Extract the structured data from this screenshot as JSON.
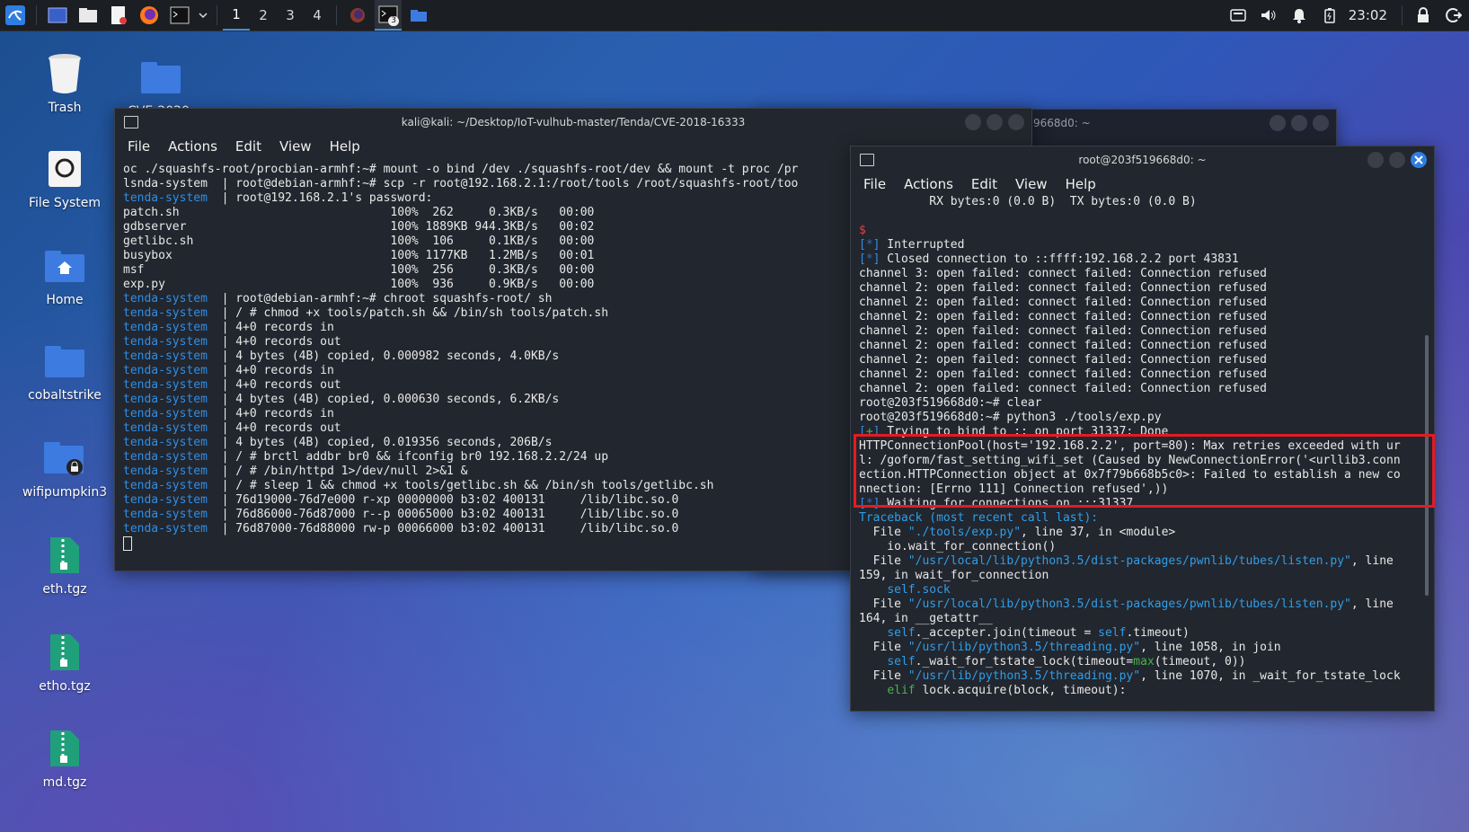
{
  "taskbar": {
    "workspaces": [
      "1",
      "2",
      "3",
      "4"
    ],
    "active_workspace": "1",
    "terminal_badge": "3",
    "clock": "23:02"
  },
  "desktop": {
    "icons": [
      {
        "label": "Trash",
        "icon": "trash-icon"
      },
      {
        "label": "File System",
        "icon": "harddisk-icon"
      },
      {
        "label": "Home",
        "icon": "home-folder-icon"
      },
      {
        "label": "cobaltstrike",
        "icon": "folder-icon"
      },
      {
        "label": "wifipumpkin3",
        "icon": "locked-folder-icon"
      },
      {
        "label": "eth.tgz",
        "icon": "archive-icon"
      },
      {
        "label": "etho.tgz",
        "icon": "archive-icon"
      },
      {
        "label": "md.tgz",
        "icon": "archive-icon"
      }
    ],
    "cve_folder_label": "CVE-2020-"
  },
  "menu": {
    "file": "File",
    "actions": "Actions",
    "edit": "Edit",
    "view": "View",
    "help": "Help"
  },
  "bg_window_title": "9668d0: ~",
  "left_terminal": {
    "title": "kali@kali: ~/Desktop/IoT-vulhub-master/Tenda/CVE-2018-16333",
    "lines": [
      {
        "prefix": "",
        "text": "oc ./squashfs-root/procbian-armhf:~# mount -o bind /dev ./squashfs-root/dev && mount -t proc /pr"
      },
      {
        "prefix": "ls",
        "text": "nda-system  | root@debian-armhf:~# scp -r root@192.168.2.1:/root/tools /root/squashfs-root/too"
      },
      {
        "prefix": "tenda-system",
        "text": "  | root@192.168.2.1's password:"
      },
      {
        "prefix": "",
        "text": "patch.sh                              100%  262     0.3KB/s   00:00"
      },
      {
        "prefix": "",
        "text": "gdbserver                             100% 1889KB 944.3KB/s   00:02"
      },
      {
        "prefix": "",
        "text": "getlibc.sh                            100%  106     0.1KB/s   00:00"
      },
      {
        "prefix": "",
        "text": "busybox                               100% 1177KB   1.2MB/s   00:01"
      },
      {
        "prefix": "",
        "text": "msf                                   100%  256     0.3KB/s   00:00"
      },
      {
        "prefix": "",
        "text": "exp.py                                100%  936     0.9KB/s   00:00"
      },
      {
        "prefix": "tenda-system",
        "text": "  | root@debian-armhf:~# chroot squashfs-root/ sh"
      },
      {
        "prefix": "tenda-system",
        "text": "  | / # chmod +x tools/patch.sh && /bin/sh tools/patch.sh"
      },
      {
        "prefix": "tenda-system",
        "text": "  | 4+0 records in"
      },
      {
        "prefix": "tenda-system",
        "text": "  | 4+0 records out"
      },
      {
        "prefix": "tenda-system",
        "text": "  | 4 bytes (4B) copied, 0.000982 seconds, 4.0KB/s"
      },
      {
        "prefix": "tenda-system",
        "text": "  | 4+0 records in"
      },
      {
        "prefix": "tenda-system",
        "text": "  | 4+0 records out"
      },
      {
        "prefix": "tenda-system",
        "text": "  | 4 bytes (4B) copied, 0.000630 seconds, 6.2KB/s"
      },
      {
        "prefix": "tenda-system",
        "text": "  | 4+0 records in"
      },
      {
        "prefix": "tenda-system",
        "text": "  | 4+0 records out"
      },
      {
        "prefix": "tenda-system",
        "text": "  | 4 bytes (4B) copied, 0.019356 seconds, 206B/s"
      },
      {
        "prefix": "tenda-system",
        "text": "  | / # brctl addbr br0 && ifconfig br0 192.168.2.2/24 up"
      },
      {
        "prefix": "tenda-system",
        "text": "  | / # /bin/httpd 1>/dev/null 2>&1 &"
      },
      {
        "prefix": "tenda-system",
        "text": "  | / # sleep 1 && chmod +x tools/getlibc.sh && /bin/sh tools/getlibc.sh"
      },
      {
        "prefix": "tenda-system",
        "text": "  | 76d19000-76d7e000 r-xp 00000000 b3:02 400131     /lib/libc.so.0"
      },
      {
        "prefix": "tenda-system",
        "text": "  | 76d86000-76d87000 r--p 00065000 b3:02 400131     /lib/libc.so.0"
      },
      {
        "prefix": "tenda-system",
        "text": "  | 76d87000-76d88000 rw-p 00066000 b3:02 400131     /lib/libc.so.0"
      }
    ]
  },
  "right_terminal": {
    "title": "root@203f519668d0: ~",
    "rx_line": "          RX bytes:0 (0.0 B)  TX bytes:0 (0.0 B)",
    "prompt_symbol": "$",
    "interrupted": " Interrupted",
    "closed": " Closed connection to ::ffff:192.168.2.2 port 43831",
    "channel_lines": [
      "channel 3: open failed: connect failed: Connection refused",
      "channel 2: open failed: connect failed: Connection refused",
      "channel 2: open failed: connect failed: Connection refused",
      "channel 2: open failed: connect failed: Connection refused",
      "channel 2: open failed: connect failed: Connection refused",
      "channel 2: open failed: connect failed: Connection refused",
      "channel 2: open failed: connect failed: Connection refused",
      "channel 2: open failed: connect failed: Connection refused",
      "channel 2: open failed: connect failed: Connection refused"
    ],
    "cmd_clear": "root@203f519668d0:~# clear",
    "cmd_exp": "root@203f519668d0:~# python3 ./tools/exp.py",
    "bind_line": " Trying to bind to :: on port 31337: Done",
    "error_lines": [
      "HTTPConnectionPool(host='192.168.2.2', port=80): Max retries exceeded with ur",
      "l: /goform/fast_setting_wifi_set (Caused by NewConnectionError('<urllib3.conn",
      "ection.HTTPConnection object at 0x7f79b668b5c0>: Failed to establish a new co",
      "nnection: [Errno 111] Connection refused',))"
    ],
    "waiting_line": " Waiting for connections on :::31337",
    "traceback_header": "Traceback (most recent call last):",
    "tb1_file": "\"./tools/exp.py\"",
    "tb1_rest": ", line 37, in <module>",
    "tb1_code": "    io.wait_for_connection()",
    "tb2_file": "\"/usr/local/lib/python3.5/dist-packages/pwnlib/tubes/listen.py\"",
    "tb2_rest": ", line",
    "tb2_cont": "159, in wait_for_connection",
    "tb2_code": "self.sock",
    "tb3_file": "\"/usr/local/lib/python3.5/dist-packages/pwnlib/tubes/listen.py\"",
    "tb3_rest": ", line",
    "tb3_cont": "164, in __getattr__",
    "tb3_code_a": "self",
    "tb3_code_b": "._accepter.join(timeout = ",
    "tb3_code_c": "self",
    "tb3_code_d": ".timeout)",
    "tb4_file": "\"/usr/lib/python3.5/threading.py\"",
    "tb4_rest": ", line 1058, in join",
    "tb4_code_a": "self",
    "tb4_code_b": "._wait_for_tstate_lock(timeout=",
    "tb4_code_c": "max",
    "tb4_code_d": "(timeout, 0))",
    "tb5_file": "\"/usr/lib/python3.5/threading.py\"",
    "tb5_rest": ", line 1070, in _wait_for_tstate_lock",
    "tb5_code_a": "elif",
    "tb5_code_b": " lock.acquire(block, timeout):",
    "file_word": "  File "
  }
}
